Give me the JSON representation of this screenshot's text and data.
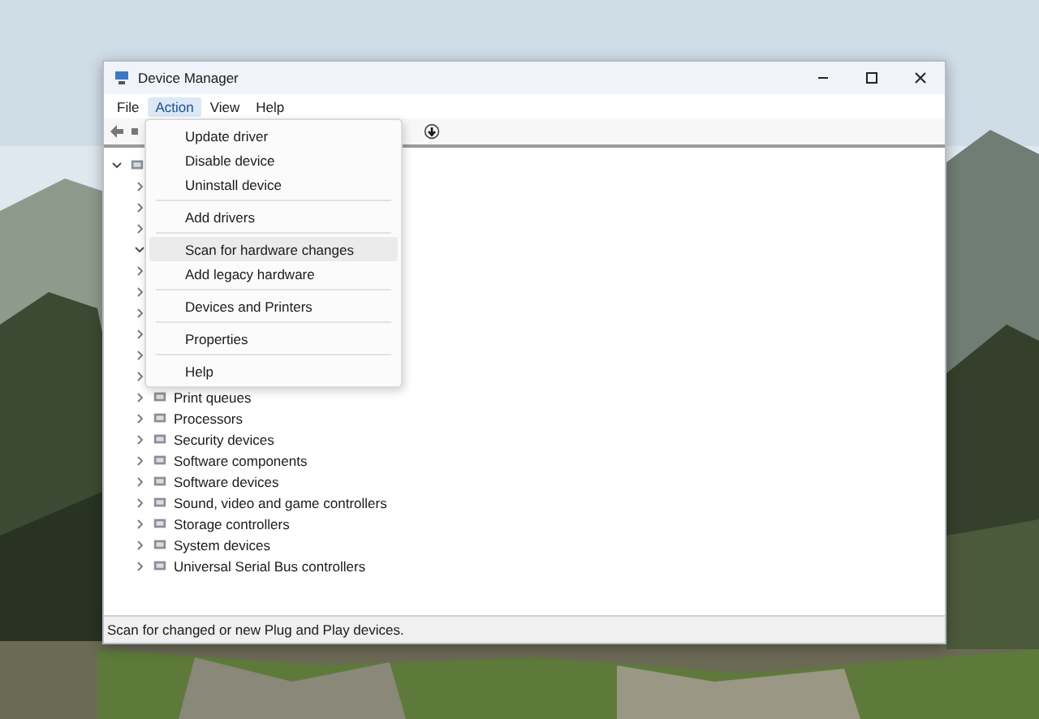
{
  "window": {
    "title": "Device Manager"
  },
  "menu_bar": [
    {
      "label": "File",
      "selected": false
    },
    {
      "label": "Action",
      "selected": true
    },
    {
      "label": "View",
      "selected": false
    },
    {
      "label": "Help",
      "selected": false
    }
  ],
  "action_menu": [
    {
      "kind": "item",
      "label": "Update driver",
      "selected": false
    },
    {
      "kind": "item",
      "label": "Disable device",
      "selected": false
    },
    {
      "kind": "item",
      "label": "Uninstall device",
      "selected": false
    },
    {
      "kind": "separator"
    },
    {
      "kind": "item",
      "label": "Add drivers",
      "selected": false
    },
    {
      "kind": "separator"
    },
    {
      "kind": "item",
      "label": "Scan for hardware changes",
      "selected": true
    },
    {
      "kind": "item",
      "label": "Add legacy hardware",
      "selected": false
    },
    {
      "kind": "separator"
    },
    {
      "kind": "item",
      "label": "Devices and Printers",
      "selected": false
    },
    {
      "kind": "separator"
    },
    {
      "kind": "item",
      "label": "Properties",
      "selected": false
    },
    {
      "kind": "separator"
    },
    {
      "kind": "item",
      "label": "Help",
      "selected": false
    }
  ],
  "tree": [
    {
      "expanded": true,
      "children": [
        {
          "expanded": false
        },
        {
          "expanded": false
        },
        {
          "expanded": false
        },
        {
          "expanded": true
        },
        {
          "expanded": false
        },
        {
          "expanded": false
        },
        {
          "expanded": false
        },
        {
          "expanded": false
        },
        {
          "expanded": false
        },
        {
          "expanded": false
        },
        {
          "label": "Print queues",
          "expanded": false
        },
        {
          "label": "Processors",
          "expanded": false
        },
        {
          "label": "Security devices",
          "expanded": false
        },
        {
          "label": "Software components",
          "expanded": false
        },
        {
          "label": "Software devices",
          "expanded": false
        },
        {
          "label": "Sound, video and game controllers",
          "expanded": false
        },
        {
          "label": "Storage controllers",
          "expanded": false
        },
        {
          "label": "System devices",
          "expanded": false
        },
        {
          "label": "Universal Serial Bus controllers",
          "expanded": false
        }
      ]
    }
  ],
  "status_bar": "Scan for changed or new Plug and Play devices."
}
